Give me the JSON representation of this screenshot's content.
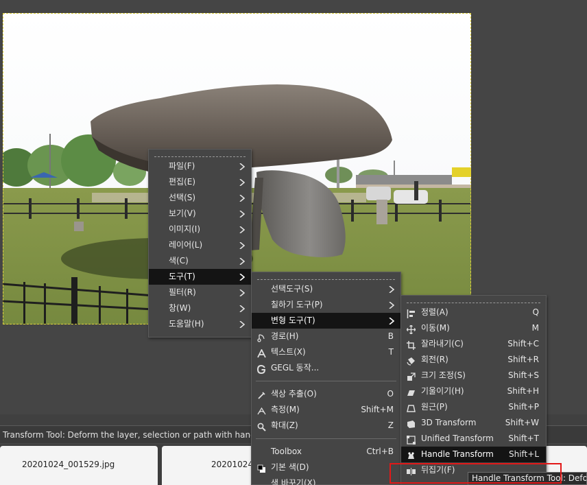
{
  "colors": {
    "menu_bg": "#454545",
    "active_bg": "#141414",
    "highlight": "#e21818",
    "selection_border": "#e0d23a"
  },
  "status_bar": {
    "text": "Transform Tool: Deform the layer, selection or path with handles"
  },
  "tabs": [
    {
      "label": "20201024_001529.jpg"
    },
    {
      "label": "20201024"
    }
  ],
  "main_menu": {
    "items": [
      {
        "label": "파일(F)"
      },
      {
        "label": "편집(E)"
      },
      {
        "label": "선택(S)"
      },
      {
        "label": "보기(V)"
      },
      {
        "label": "이미지(I)"
      },
      {
        "label": "레이어(L)"
      },
      {
        "label": "색(C)"
      },
      {
        "label": "도구(T)"
      },
      {
        "label": "필터(R)"
      },
      {
        "label": "창(W)"
      },
      {
        "label": "도움말(H)"
      }
    ]
  },
  "tools_menu": {
    "items": [
      {
        "label": "선택도구(S)"
      },
      {
        "label": "칠하기 도구(P)"
      },
      {
        "label": "변형 도구(T)"
      },
      {
        "label": "경로(H)",
        "accel": "B",
        "icon": "path-icon"
      },
      {
        "label": "텍스트(X)",
        "accel": "T",
        "icon": "text-tool-icon"
      },
      {
        "label": "GEGL 동작...",
        "icon": "gegl-icon"
      },
      {
        "label": "색상 추출(O)",
        "accel": "O",
        "icon": "color-picker-icon"
      },
      {
        "label": "측정(M)",
        "accel": "Shift+M",
        "icon": "measure-icon"
      },
      {
        "label": "확대(Z)",
        "accel": "Z",
        "icon": "zoom-icon"
      },
      {
        "label": "Toolbox",
        "accel": "Ctrl+B"
      },
      {
        "label": "기본 색(D)",
        "icon": "default-colors-icon"
      },
      {
        "label": "색 바꾸기(X)"
      }
    ]
  },
  "transform_menu": {
    "items": [
      {
        "label": "정렬(A)",
        "accel": "Q",
        "icon": "align-icon"
      },
      {
        "label": "이동(M)",
        "accel": "M",
        "icon": "move-icon"
      },
      {
        "label": "잘라내기(C)",
        "accel": "Shift+C",
        "icon": "crop-icon"
      },
      {
        "label": "회전(R)",
        "accel": "Shift+R",
        "icon": "rotate-icon"
      },
      {
        "label": "크기 조정(S)",
        "accel": "Shift+S",
        "icon": "scale-icon"
      },
      {
        "label": "기울이기(H)",
        "accel": "Shift+H",
        "icon": "shear-icon"
      },
      {
        "label": "원근(P)",
        "accel": "Shift+P",
        "icon": "perspective-icon"
      },
      {
        "label": "3D Transform",
        "accel": "Shift+W",
        "icon": "3d-transform-icon"
      },
      {
        "label": "Unified Transform",
        "accel": "Shift+T",
        "icon": "unified-transform-icon"
      },
      {
        "label": "Handle Transform",
        "accel": "Shift+L",
        "icon": "handle-transform-icon"
      },
      {
        "label": "뒤집기(F)",
        "icon": "flip-icon"
      }
    ]
  },
  "tooltip": {
    "text": "Handle Transform Tool: Defo"
  }
}
